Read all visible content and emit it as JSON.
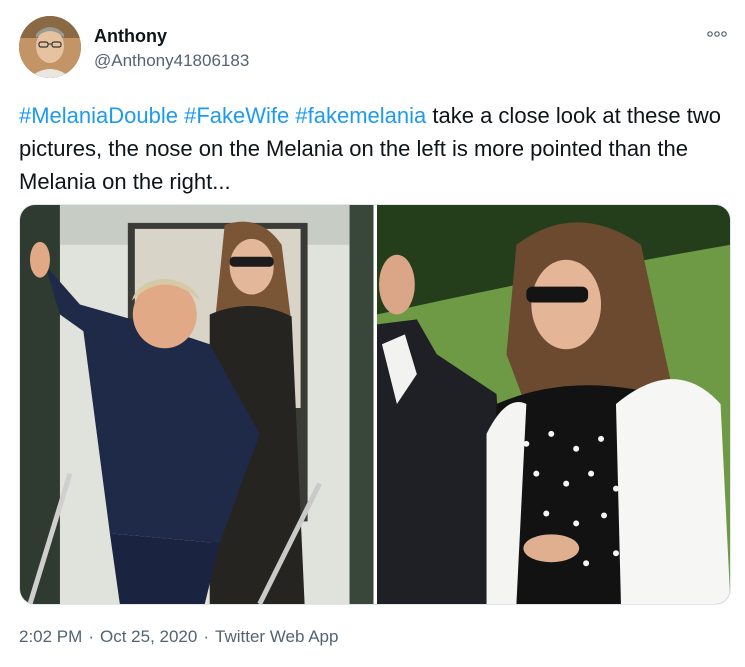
{
  "author": {
    "name": "Anthony",
    "handle": "@Anthony41806183",
    "avatar_icon": "profile-photo"
  },
  "more_icon": "more-horizontal-icon",
  "tweet": {
    "hashtags": [
      "#MelaniaDouble",
      "#FakeWife",
      "#fakemelania"
    ],
    "sep": " ",
    "body": " take a close look at these two pictures, the nose on the Melania on the left is more pointed than the Melania on the right..."
  },
  "media": {
    "photos": [
      {
        "label": "left-photo"
      },
      {
        "label": "right-photo"
      }
    ]
  },
  "footer": {
    "time": "2:02 PM",
    "dot1": "·",
    "date": "Oct 25, 2020",
    "dot2": "·",
    "source": "Twitter Web App"
  },
  "colors": {
    "link": "#1d9bf0",
    "text": "#0f1419",
    "secondary": "#536471"
  }
}
